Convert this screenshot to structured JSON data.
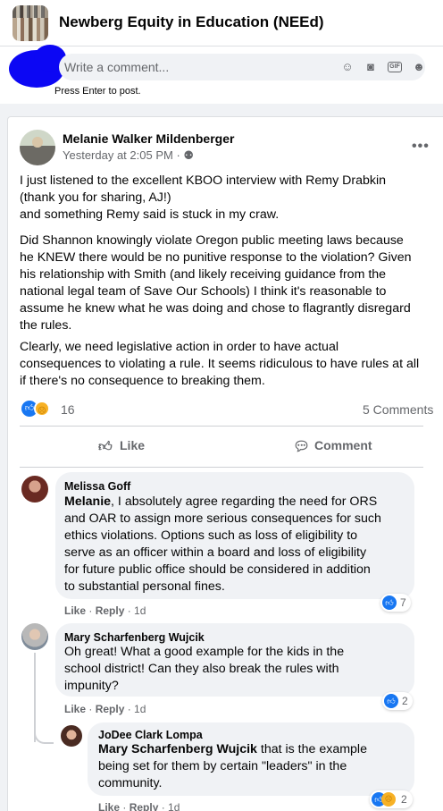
{
  "group": {
    "title": "Newberg Equity in Education (NEEd)"
  },
  "composer": {
    "placeholder": "Write a comment...",
    "hint": "Press Enter to post.",
    "icons": [
      "emoji-icon",
      "camera-icon",
      "gif-icon",
      "sticker-icon"
    ],
    "gif_label": "GIF"
  },
  "post": {
    "author": "Melanie Walker Mildenberger",
    "timestamp": "Yesterday at 2:05 PM",
    "privacy_icon": "group-icon",
    "paragraphs": [
      "I just listened to the excellent KBOO interview with Remy Drabkin\n(thank you for sharing, AJ!)\nand something Remy said is stuck in my craw.",
      "Did Shannon knowingly violate Oregon public meeting laws because\nhe KNEW there would be no punitive response to the violation? Given\nhis relationship with Smith (and likely receiving guidance from the\nnational legal team of Save Our Schools) I think it's reasonable to\nassume he knew what he was doing and chose to flagrantly disregard\nthe rules.",
      "Clearly, we need legislative action in order to have actual\nconsequences to violating a rule. It seems ridiculous to have rules at all\nif there's no consequence to breaking them."
    ],
    "reaction_count": "16",
    "comments_count": "5 Comments",
    "like_label": "Like",
    "comment_label": "Comment"
  },
  "comments": [
    {
      "name": "Melissa Goff",
      "mention": "Melanie",
      "text": ", I absolutely agree regarding the need for ORS\nand OAR to assign more serious consequences for such\nethics violations. Options such as loss of eligibility to\nserve as an officer within a board and loss of eligibility\nfor future public office should be considered in addition\nto substantial personal fines.",
      "like": "Like",
      "reply": "Reply",
      "age": "1d",
      "reactions": "7"
    },
    {
      "name": "Mary Scharfenberg Wujcik",
      "mention": "",
      "text": "Oh great! What a good example for the kids in the\nschool district! Can they also break the rules with\nimpunity?",
      "like": "Like",
      "reply": "Reply",
      "age": "1d",
      "reactions": "2"
    },
    {
      "name": "JoDee Clark Lompa",
      "mention": "Mary Scharfenberg Wujcik",
      "text": " that is the example\nbeing set for them by certain \"leaders\" in the\ncommunity.",
      "like": "Like",
      "reply": "Reply",
      "age": "1d",
      "reactions": "2"
    }
  ],
  "colors": {
    "accent": "#1877f2",
    "muted": "#65676b",
    "bubble": "#f0f2f5",
    "redaction": "#0c07f4"
  }
}
